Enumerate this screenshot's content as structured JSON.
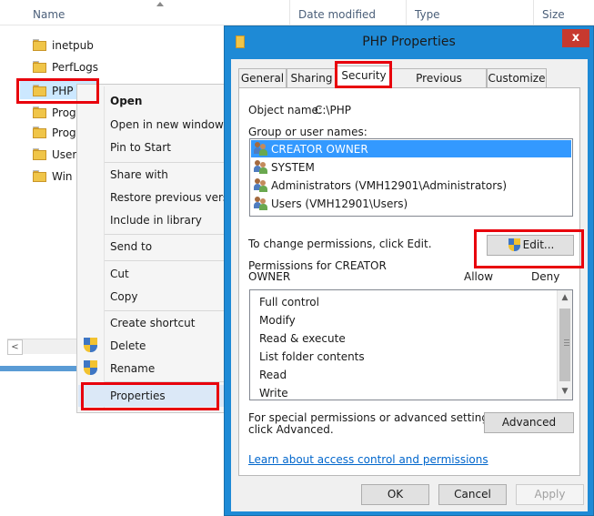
{
  "explorer": {
    "columns": [
      "Name",
      "Date modified",
      "Type",
      "Size"
    ],
    "folders": [
      "inetpub",
      "PerfLogs",
      "PHP",
      "Prog",
      "Prog",
      "User",
      "Win"
    ]
  },
  "context_menu": {
    "items": [
      {
        "label": "Open",
        "bold": true
      },
      {
        "label": "Open in new window"
      },
      {
        "label": "Pin to Start"
      },
      {
        "label": "Share with"
      },
      {
        "label": "Restore previous versions"
      },
      {
        "label": "Include in library"
      },
      {
        "label": "Send to"
      },
      {
        "label": "Cut"
      },
      {
        "label": "Copy"
      },
      {
        "label": "Create shortcut"
      },
      {
        "label": "Delete",
        "icon": "uac-shield-icon"
      },
      {
        "label": "Rename",
        "icon": "uac-shield-icon"
      },
      {
        "label": "Properties"
      }
    ]
  },
  "dialog": {
    "title": "PHP Properties",
    "close_label": "x",
    "tabs": [
      "General",
      "Sharing",
      "Security",
      "Previous Versions",
      "Customize"
    ],
    "active_tab": "Security",
    "object_name_label": "Object name:",
    "object_name_value": "C:\\PHP",
    "group_label": "Group or user names:",
    "users": [
      "CREATOR OWNER",
      "SYSTEM",
      "Administrators (VMH12901\\Administrators)",
      "Users (VMH12901\\Users)"
    ],
    "selected_user": "CREATOR OWNER",
    "change_text": "To change permissions, click Edit.",
    "edit_button": "Edit...",
    "permissions_label_line1": "Permissions for CREATOR",
    "permissions_label_line2": "OWNER",
    "allow_header": "Allow",
    "deny_header": "Deny",
    "permissions": [
      "Full control",
      "Modify",
      "Read & execute",
      "List folder contents",
      "Read",
      "Write"
    ],
    "special_text_line1": "For special permissions or advanced settings,",
    "special_text_line2": "click Advanced.",
    "advanced_button": "Advanced",
    "learn_link": "Learn about access control and permissions",
    "ok_button": "OK",
    "cancel_button": "Cancel",
    "apply_button": "Apply"
  },
  "colors": {
    "highlight": "#e8000c",
    "dialog_frame": "#1e8ad6",
    "selection": "#3399ff",
    "link": "#0066cc"
  }
}
